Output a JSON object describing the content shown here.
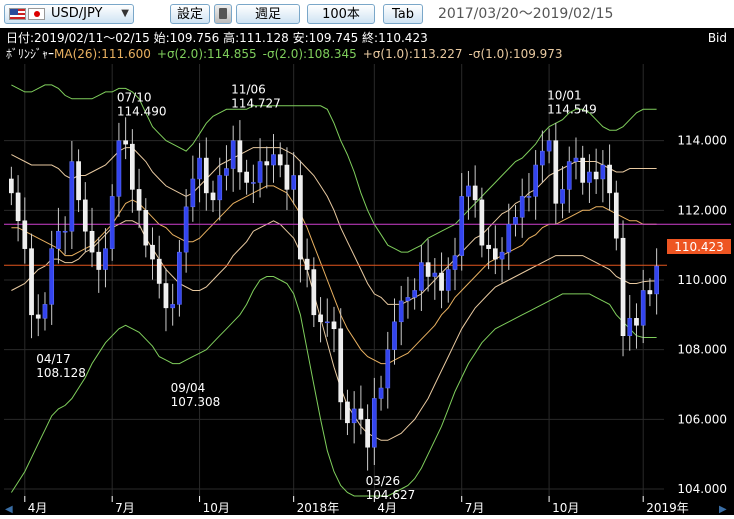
{
  "toolbar": {
    "pair": "USD/JPY",
    "settings_label": "設定",
    "period_label": "週足",
    "count_label": "100本",
    "tab_label": "Tab",
    "date_range": "2017/03/20～2019/02/15"
  },
  "info": {
    "ohlc_line": "日付:2019/02/11～02/15 始:109.756 高:111.128 安:109.745 終:110.423",
    "bid_label": "Bid",
    "bollinger_prefix": "ﾎﾞﾘﾝｼﾞｬｰ",
    "ma_label": "MA(26):111.600",
    "p2_label": "+σ(2.0):114.855",
    "m2_label": "-σ(2.0):108.345",
    "p1_label": "+σ(1.0):113.227",
    "m1_label": "-σ(1.0):109.973"
  },
  "colors": {
    "up": "#3344ee",
    "down": "#eeeeee",
    "wick": "#cccccc",
    "ma": "#e8b060",
    "sigma2": "#7fce5c",
    "sigma1": "#e8c9a0",
    "h_magenta": "#d040d0",
    "h_orange": "#e2561e",
    "price_tag": "#ee5522"
  },
  "chart_data": {
    "type": "candlestick",
    "ylim": [
      103.8,
      116.2
    ],
    "y_ticks": [
      "114.000",
      "112.000",
      "110.000",
      "108.000",
      "106.000",
      "104.000"
    ],
    "x_labels": [
      "4月",
      "7月",
      "10月",
      "2018年",
      "4月",
      "7月",
      "10月",
      "2019年"
    ],
    "x_label_index": [
      2,
      15,
      28,
      42,
      54,
      67,
      80,
      94
    ],
    "current_price": "110.423",
    "magenta_level": 111.6,
    "annotations": [
      {
        "date": "04/17",
        "price": "108.128",
        "index": 4,
        "kind": "low"
      },
      {
        "date": "07/10",
        "price": "114.490",
        "index": 16,
        "kind": "high"
      },
      {
        "date": "09/04",
        "price": "107.308",
        "index": 24,
        "kind": "low"
      },
      {
        "date": "11/06",
        "price": "114.727",
        "index": 33,
        "kind": "high"
      },
      {
        "date": "03/26",
        "price": "104.627",
        "index": 53,
        "kind": "low"
      },
      {
        "date": "10/01",
        "price": "114.549",
        "index": 80,
        "kind": "high"
      }
    ],
    "closes": [
      112.5,
      111.7,
      110.9,
      109.0,
      108.9,
      109.3,
      110.9,
      111.4,
      111.4,
      113.4,
      112.3,
      111.4,
      110.8,
      110.3,
      110.9,
      112.4,
      114.0,
      113.9,
      112.6,
      112.0,
      111.0,
      110.6,
      109.9,
      109.2,
      109.3,
      110.8,
      112.1,
      112.9,
      113.5,
      112.5,
      112.3,
      113.0,
      113.2,
      114.0,
      113.1,
      112.8,
      112.8,
      113.4,
      113.3,
      113.6,
      113.3,
      112.6,
      113.0,
      110.6,
      110.3,
      109.0,
      108.8,
      108.8,
      108.6,
      106.5,
      105.9,
      106.3,
      106.0,
      105.2,
      106.6,
      106.9,
      108.0,
      108.8,
      109.4,
      109.5,
      109.7,
      110.5,
      110.1,
      110.2,
      109.7,
      110.3,
      110.7,
      112.4,
      112.7,
      112.3,
      111.0,
      110.9,
      110.6,
      110.8,
      111.6,
      111.8,
      112.4,
      112.4,
      113.3,
      113.7,
      114.0,
      112.2,
      112.6,
      113.4,
      113.5,
      112.8,
      113.1,
      112.9,
      113.3,
      112.5,
      111.2,
      108.4,
      108.9,
      108.7,
      109.7,
      109.6,
      110.4
    ],
    "ma": [
      111.5,
      111.5,
      111.4,
      111.3,
      111.2,
      111.1,
      111.0,
      110.9,
      110.7,
      110.7,
      110.8,
      110.9,
      111.0,
      111.2,
      111.4,
      111.6,
      111.9,
      112.2,
      112.3,
      112.2,
      112.0,
      111.8,
      111.6,
      111.5,
      111.3,
      111.2,
      111.1,
      111.1,
      111.2,
      111.4,
      111.6,
      111.8,
      112.0,
      112.2,
      112.3,
      112.4,
      112.5,
      112.6,
      112.7,
      112.7,
      112.6,
      112.5,
      112.2,
      111.9,
      111.5,
      111.0,
      110.5,
      110.0,
      109.5,
      109.0,
      108.6,
      108.3,
      108.0,
      107.8,
      107.7,
      107.6,
      107.6,
      107.7,
      107.8,
      107.9,
      108.1,
      108.3,
      108.5,
      108.7,
      109.0,
      109.2,
      109.5,
      109.7,
      109.9,
      110.1,
      110.3,
      110.5,
      110.6,
      110.7,
      110.8,
      110.9,
      111.0,
      111.2,
      111.3,
      111.5,
      111.6,
      111.6,
      111.7,
      111.8,
      111.9,
      112.0,
      112.0,
      112.1,
      112.1,
      112.0,
      111.9,
      111.8,
      111.7,
      111.7,
      111.6,
      111.6,
      111.6
    ],
    "plus2": [
      115.6,
      115.5,
      115.4,
      115.4,
      115.5,
      115.6,
      115.6,
      115.5,
      115.3,
      115.2,
      115.2,
      115.2,
      115.2,
      115.3,
      115.4,
      115.4,
      115.5,
      115.5,
      115.4,
      115.2,
      114.8,
      114.4,
      114.2,
      114.0,
      113.9,
      113.8,
      113.7,
      113.9,
      114.2,
      114.5,
      114.7,
      114.8,
      114.9,
      114.9,
      114.9,
      114.9,
      115.0,
      115.0,
      115.0,
      115.0,
      115.0,
      115.0,
      115.0,
      115.0,
      115.0,
      115.0,
      115.0,
      114.9,
      114.5,
      114.0,
      113.6,
      113.1,
      112.5,
      112.0,
      111.6,
      111.3,
      111.0,
      110.9,
      110.8,
      110.8,
      110.9,
      111.0,
      111.2,
      111.3,
      111.4,
      111.5,
      111.6,
      111.8,
      112.0,
      112.2,
      112.4,
      112.6,
      112.8,
      113.0,
      113.2,
      113.4,
      113.5,
      113.7,
      113.9,
      114.2,
      114.4,
      114.5,
      114.6,
      114.8,
      114.9,
      114.9,
      114.8,
      114.6,
      114.4,
      114.3,
      114.3,
      114.4,
      114.6,
      114.8,
      114.9,
      114.9,
      114.9
    ],
    "minus2": [
      103.9,
      104.2,
      104.5,
      104.9,
      105.3,
      105.7,
      106.1,
      106.3,
      106.4,
      106.6,
      106.9,
      107.2,
      107.6,
      107.9,
      108.2,
      108.4,
      108.6,
      108.7,
      108.6,
      108.5,
      108.3,
      108.1,
      107.8,
      107.7,
      107.6,
      107.6,
      107.7,
      107.8,
      107.9,
      108.0,
      108.2,
      108.4,
      108.6,
      108.8,
      109.0,
      109.3,
      109.7,
      110.0,
      110.1,
      110.1,
      110.0,
      109.9,
      109.6,
      109.0,
      108.0,
      107.0,
      106.0,
      105.1,
      104.5,
      104.1,
      103.9,
      103.8,
      103.8,
      103.8,
      103.8,
      103.8,
      103.8,
      103.9,
      104.0,
      104.1,
      104.3,
      104.6,
      105.0,
      105.4,
      105.8,
      106.3,
      106.8,
      107.2,
      107.6,
      107.9,
      108.2,
      108.4,
      108.6,
      108.7,
      108.8,
      108.9,
      109.0,
      109.1,
      109.2,
      109.3,
      109.4,
      109.5,
      109.6,
      109.6,
      109.6,
      109.6,
      109.6,
      109.5,
      109.4,
      109.3,
      109.0,
      108.8,
      108.6,
      108.4,
      108.35,
      108.35,
      108.35
    ],
    "plus1": [
      113.6,
      113.5,
      113.4,
      113.3,
      113.3,
      113.3,
      113.3,
      113.2,
      113.0,
      112.9,
      113.0,
      113.0,
      113.1,
      113.2,
      113.3,
      113.5,
      113.7,
      113.8,
      113.8,
      113.6,
      113.4,
      113.1,
      112.9,
      112.7,
      112.6,
      112.5,
      112.4,
      112.5,
      112.7,
      112.9,
      113.1,
      113.3,
      113.4,
      113.5,
      113.6,
      113.7,
      113.8,
      113.8,
      113.8,
      113.8,
      113.8,
      113.7,
      113.6,
      113.4,
      113.2,
      113.0,
      112.7,
      112.4,
      112.0,
      111.5,
      111.1,
      110.7,
      110.3,
      109.9,
      109.6,
      109.5,
      109.3,
      109.3,
      109.3,
      109.4,
      109.5,
      109.6,
      109.8,
      110.0,
      110.2,
      110.4,
      110.6,
      110.8,
      111.0,
      111.2,
      111.3,
      111.5,
      111.7,
      111.9,
      112.0,
      112.2,
      112.3,
      112.5,
      112.6,
      112.8,
      113.0,
      113.1,
      113.2,
      113.3,
      113.4,
      113.4,
      113.4,
      113.4,
      113.3,
      113.2,
      113.1,
      113.1,
      113.2,
      113.2,
      113.2,
      113.2,
      113.2
    ],
    "minus1": [
      109.7,
      109.8,
      109.9,
      110.1,
      110.3,
      110.4,
      110.6,
      110.6,
      110.5,
      110.5,
      110.6,
      110.8,
      110.9,
      111.1,
      111.3,
      111.5,
      111.6,
      111.7,
      111.7,
      111.6,
      111.2,
      110.9,
      110.6,
      110.3,
      110.1,
      109.9,
      109.8,
      109.7,
      109.7,
      109.8,
      110.0,
      110.2,
      110.4,
      110.7,
      110.9,
      111.1,
      111.4,
      111.5,
      111.6,
      111.7,
      111.6,
      111.4,
      111.2,
      110.8,
      110.3,
      109.6,
      108.9,
      108.2,
      107.5,
      106.9,
      106.4,
      106.1,
      105.8,
      105.6,
      105.5,
      105.4,
      105.4,
      105.5,
      105.6,
      105.8,
      106.0,
      106.3,
      106.6,
      107.0,
      107.4,
      107.8,
      108.2,
      108.6,
      108.9,
      109.2,
      109.4,
      109.6,
      109.8,
      109.9,
      110.0,
      110.1,
      110.2,
      110.3,
      110.4,
      110.5,
      110.6,
      110.7,
      110.7,
      110.7,
      110.7,
      110.7,
      110.6,
      110.5,
      110.4,
      110.3,
      110.1,
      110.0,
      109.9,
      109.9,
      109.95,
      109.97,
      109.97
    ]
  }
}
